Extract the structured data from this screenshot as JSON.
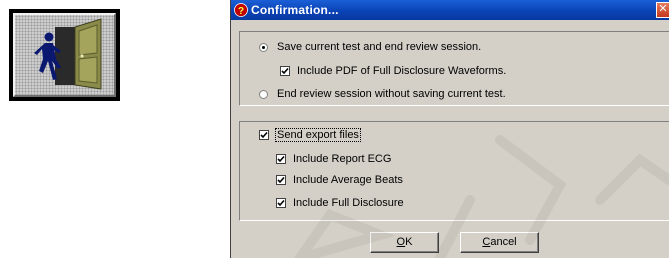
{
  "dialog": {
    "title": "Confirmation...",
    "close_label": "✕",
    "option_save_end": "Save current test and end review session.",
    "option_include_pdf": "Include PDF of Full Disclosure Waveforms.",
    "option_end_no_save": "End review session without saving current test.",
    "send_export_files": "Send export files",
    "include_report_ecg": "Include Report ECG",
    "include_average_beats": "Include Average Beats",
    "include_full_disclosure": "Include Full Disclosure",
    "ok_first": "O",
    "ok_rest": "K",
    "cancel_first": "C",
    "cancel_rest": "ancel"
  },
  "state": {
    "save_end_selected": true,
    "include_pdf_checked": true,
    "end_no_save_selected": false,
    "send_export_checked": true,
    "report_ecg_checked": true,
    "average_beats_checked": true,
    "full_disclosure_checked": true
  },
  "icons": {
    "toolbar_button": "exit-door-icon",
    "title": "question-icon",
    "close": "close-icon"
  },
  "colors": {
    "titlebar": "#0a43b6",
    "dialog_bg": "#d4d0c8",
    "door": "#8a8a4a",
    "figure": "#0a1870"
  }
}
